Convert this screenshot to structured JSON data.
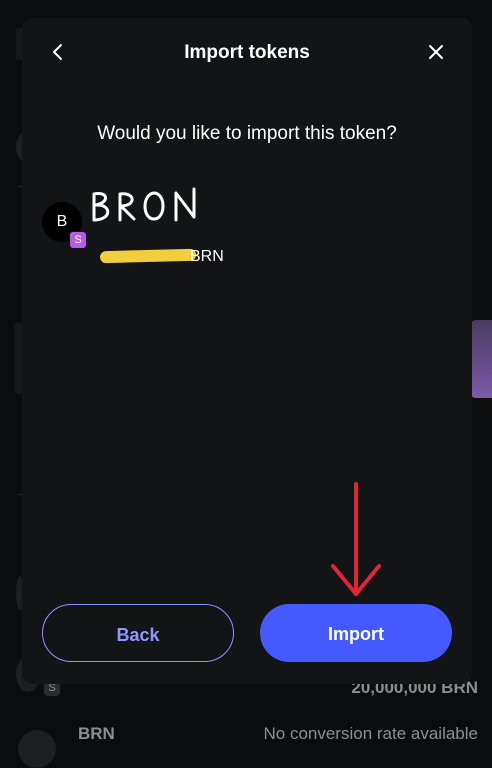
{
  "modal": {
    "title": "Import tokens",
    "question": "Would you like to import this token?",
    "back_label": "Back",
    "import_label": "Import"
  },
  "token": {
    "avatar_letter": "B",
    "network_letter": "S",
    "handwritten_name": "BRON",
    "symbol": "BRN"
  },
  "background": {
    "token_row_name": "BRN",
    "token_row_rate": "No conversion rate available",
    "token_row_balance": "20,000,000 BRN",
    "network_letter": "S"
  },
  "colors": {
    "accent": "#4459ff",
    "accent_outline": "#8f97ff",
    "network_badge": "#b85ce6",
    "annotation_arrow": "#e0243a",
    "redaction": "#f0cf3a"
  },
  "icons": {
    "back": "chevron-left-icon",
    "close": "close-icon"
  }
}
